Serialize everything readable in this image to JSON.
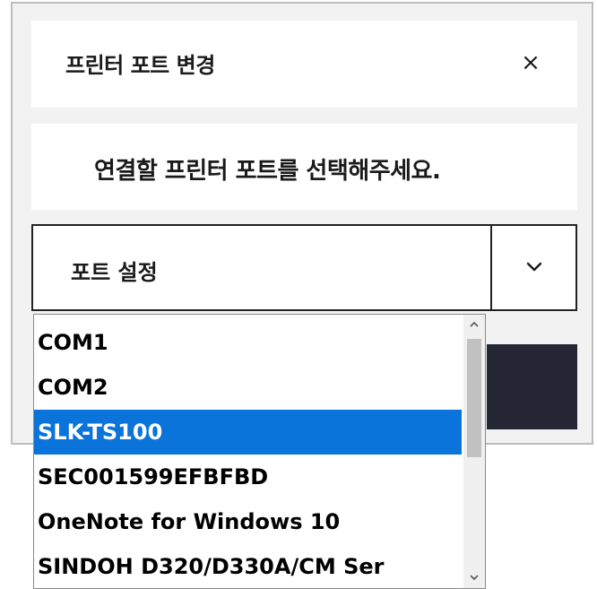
{
  "dialog": {
    "title": "프린터 포트 변경",
    "close_label": "×",
    "message": "연결할 프린터 포트를 선택해주세요."
  },
  "port_select": {
    "selected_label": "포트 설정",
    "options": [
      {
        "label": "COM1",
        "selected": false
      },
      {
        "label": "COM2",
        "selected": false
      },
      {
        "label": "SLK-TS100",
        "selected": true
      },
      {
        "label": "SEC001599EFBFBD",
        "selected": false
      },
      {
        "label": "OneNote for Windows 10",
        "selected": false
      },
      {
        "label": "SINDOH D320/D330A/CM Ser",
        "selected": false
      }
    ]
  },
  "colors": {
    "accent_selected": "#0a74da",
    "confirm_button": "#242733",
    "dialog_background": "#f2f2f2"
  },
  "icons": {
    "close": "close-icon",
    "dropdown": "chevron-down-icon",
    "scroll_up": "scroll-up-arrow-icon",
    "scroll_down": "scroll-down-arrow-icon"
  }
}
